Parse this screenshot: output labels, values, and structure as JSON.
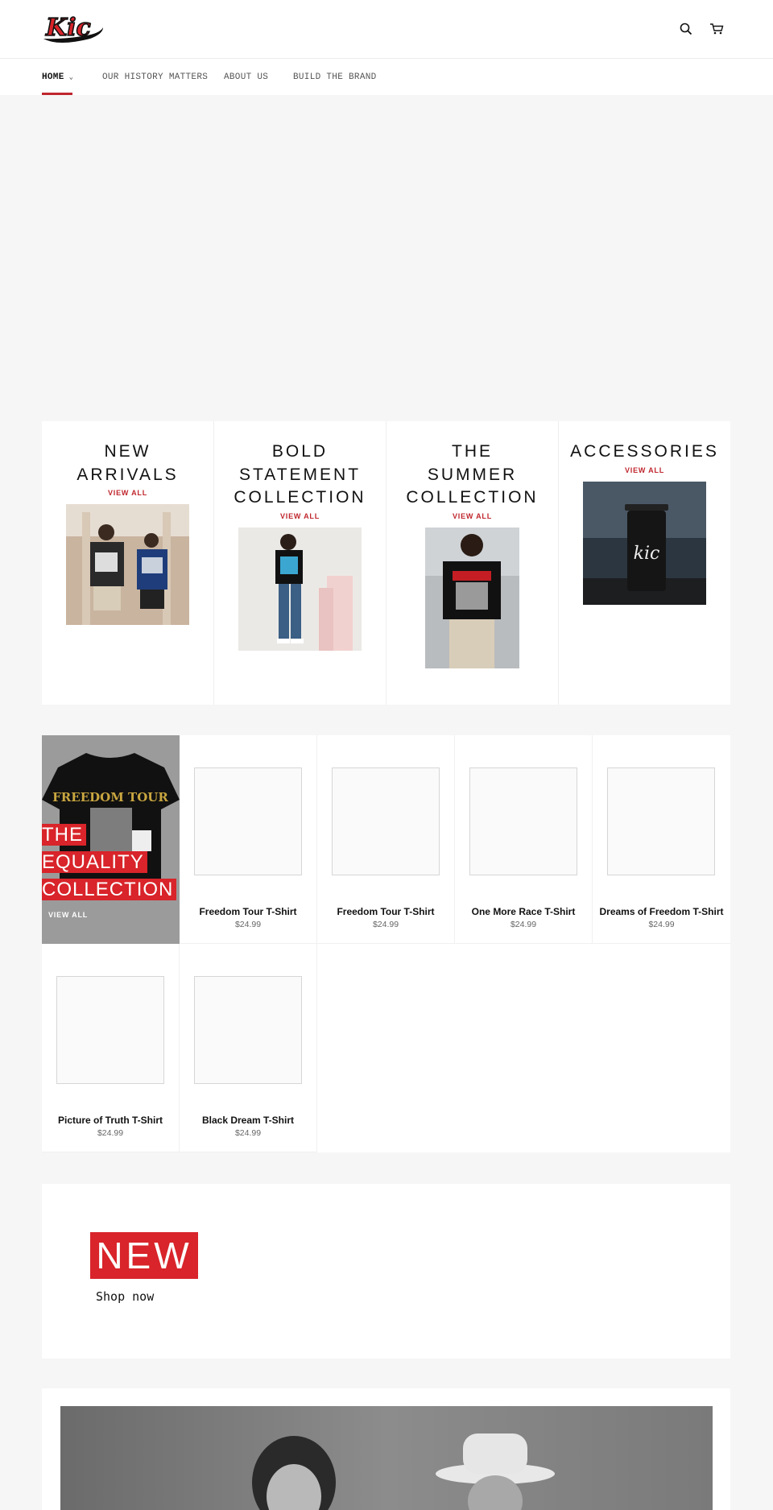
{
  "brand": {
    "logo_text": "Kic",
    "accent_color": "#c0262d",
    "red": "#d8242a"
  },
  "header": {
    "icons": [
      "search-icon",
      "cart-icon"
    ]
  },
  "nav": {
    "items": [
      {
        "label": "HOME",
        "has_dropdown": true,
        "active": true
      },
      {
        "label": "OUR HISTORY MATTERS",
        "has_dropdown": false,
        "active": false
      },
      {
        "label": "ABOUT US",
        "has_dropdown": false,
        "active": false
      },
      {
        "label": "BUILD THE BRAND",
        "has_dropdown": false,
        "active": false
      }
    ]
  },
  "collections": [
    {
      "title_lines": [
        "NEW",
        "ARRIVALS"
      ],
      "view_label": "VIEW ALL"
    },
    {
      "title_lines": [
        "BOLD",
        "STATEMENT",
        "COLLECTION"
      ],
      "view_label": "VIEW ALL"
    },
    {
      "title_lines": [
        "THE",
        "SUMMER",
        "COLLECTION"
      ],
      "view_label": "VIEW ALL"
    },
    {
      "title_lines": [
        "ACCESSORIES"
      ],
      "view_label": "VIEW ALL"
    }
  ],
  "featured_collection": {
    "title_lines": [
      "THE",
      "EQUALITY",
      "COLLECTION"
    ],
    "view_label": "VIEW ALL",
    "shirt_text": "FREEDOM TOUR"
  },
  "products": [
    {
      "name": "Freedom Tour T-Shirt",
      "price": "$24.99"
    },
    {
      "name": "Freedom Tour T-Shirt",
      "price": "$24.99"
    },
    {
      "name": "One More Race T-Shirt",
      "price": "$24.99"
    },
    {
      "name": "Dreams of Freedom T-Shirt",
      "price": "$24.99"
    },
    {
      "name": "Picture of Truth T-Shirt",
      "price": "$24.99"
    },
    {
      "name": "Black Dream T-Shirt",
      "price": "$24.99"
    }
  ],
  "banner": {
    "badge": "NEW",
    "cta": "Shop now"
  },
  "tumbler_text": "kic"
}
